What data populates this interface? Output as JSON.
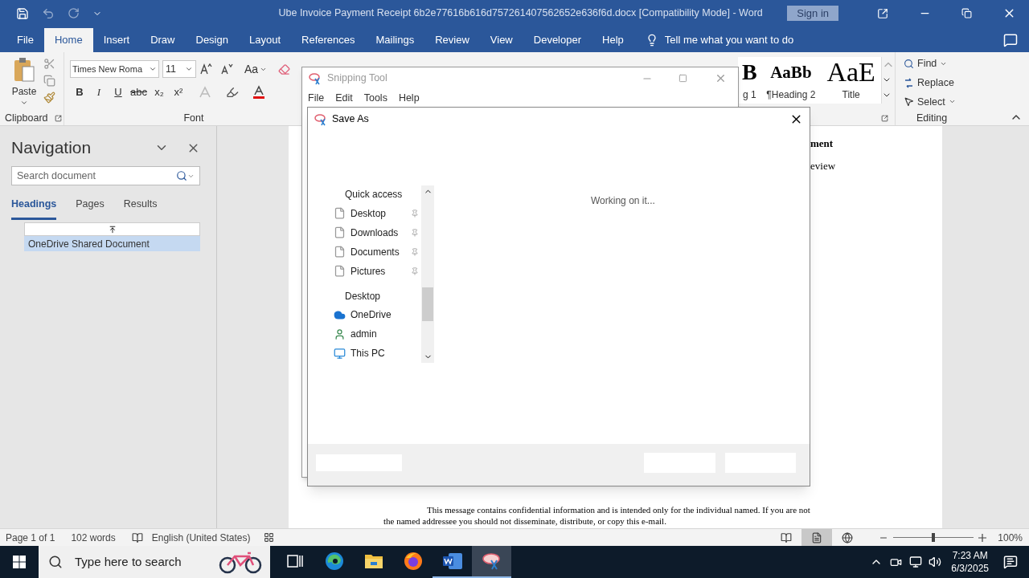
{
  "window": {
    "title": "Ube Invoice Payment Receipt 6b2e77616b616d757261407562652e636f6d.docx [Compatibility Mode]  -  Word",
    "sign_in": "Sign in"
  },
  "tabs": [
    {
      "label": "File",
      "selected": false
    },
    {
      "label": "Home",
      "selected": true
    },
    {
      "label": "Insert",
      "selected": false
    },
    {
      "label": "Draw",
      "selected": false
    },
    {
      "label": "Design",
      "selected": false
    },
    {
      "label": "Layout",
      "selected": false
    },
    {
      "label": "References",
      "selected": false
    },
    {
      "label": "Mailings",
      "selected": false
    },
    {
      "label": "Review",
      "selected": false
    },
    {
      "label": "View",
      "selected": false
    },
    {
      "label": "Developer",
      "selected": false
    },
    {
      "label": "Help",
      "selected": false
    }
  ],
  "tell_me": "Tell me what you want to do",
  "ribbon": {
    "clipboard": {
      "paste": "Paste",
      "label": "Clipboard"
    },
    "font": {
      "name": "Times New Roma",
      "size": "11",
      "change_case": "Aa",
      "format_buttons": [
        "B",
        "I",
        "U",
        "abc",
        "x₂",
        "x²"
      ],
      "label": "Font"
    },
    "styles": [
      {
        "preview": "B",
        "name": "g 1"
      },
      {
        "preview": "AaBb",
        "name": "¶Heading 2"
      },
      {
        "preview": "AaE",
        "name": "Title"
      }
    ],
    "editing": {
      "items": [
        "Find",
        "Replace",
        "Select"
      ],
      "label": "Editing"
    }
  },
  "navigation": {
    "title": "Navigation",
    "search_placeholder": "Search document",
    "tabs": [
      {
        "label": "Headings",
        "selected": true
      },
      {
        "label": "Pages",
        "selected": false
      },
      {
        "label": "Results",
        "selected": false
      }
    ],
    "headings": [
      {
        "label": "OneDrive Shared Document",
        "selected": true
      }
    ]
  },
  "document": {
    "fragments": [
      "ment",
      "eview"
    ],
    "footer_lines": [
      "This message contains confidential information and is intended only for the individual named. If you are not",
      "the named addressee you should not disseminate, distribute, or copy this e-mail."
    ]
  },
  "snipping_tool": {
    "title": "Snipping Tool",
    "menu": [
      "File",
      "Edit",
      "Tools",
      "Help"
    ]
  },
  "save_as": {
    "title": "Save As",
    "status": "Working on it...",
    "nav": [
      {
        "kind": "header",
        "label": "Quick access"
      },
      {
        "kind": "file",
        "label": "Desktop",
        "pinned": true
      },
      {
        "kind": "file",
        "label": "Downloads",
        "pinned": true
      },
      {
        "kind": "file",
        "label": "Documents",
        "pinned": true
      },
      {
        "kind": "file",
        "label": "Pictures",
        "pinned": true
      },
      {
        "kind": "header",
        "label": "Desktop"
      },
      {
        "kind": "cloud",
        "label": "OneDrive"
      },
      {
        "kind": "user",
        "label": "admin"
      },
      {
        "kind": "pc",
        "label": "This PC"
      }
    ]
  },
  "status_bar": {
    "page": "Page 1 of 1",
    "words": "102 words",
    "language": "English (United States)",
    "views": [
      {
        "kind": "read",
        "selected": false
      },
      {
        "kind": "print",
        "selected": true
      },
      {
        "kind": "web",
        "selected": false
      }
    ],
    "zoom": {
      "level": 0.5,
      "reading": "100%"
    }
  },
  "taskbar": {
    "search_placeholder": "Type here to search",
    "apps": [
      {
        "kind": "taskview",
        "running": false,
        "active": false
      },
      {
        "kind": "edge",
        "running": false,
        "active": false
      },
      {
        "kind": "explorer",
        "running": false,
        "active": false
      },
      {
        "kind": "firefox",
        "running": false,
        "active": false
      },
      {
        "kind": "word",
        "running": true,
        "active": false
      },
      {
        "kind": "snip",
        "running": true,
        "active": true
      }
    ],
    "time": "7:23 AM",
    "date": "6/3/2025"
  }
}
